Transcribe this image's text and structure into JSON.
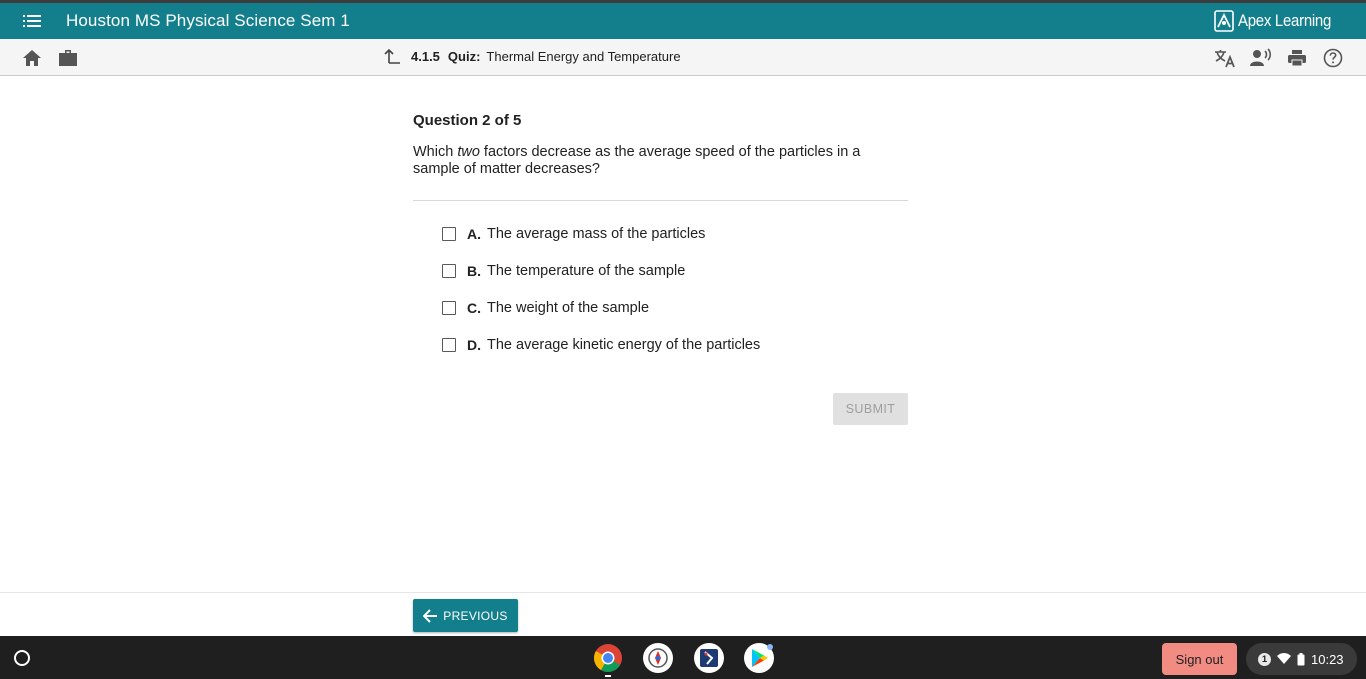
{
  "app": {
    "course_title": "Houston MS Physical Science Sem 1",
    "brand": "Apex Learning",
    "accent_color": "#137f8c"
  },
  "toolbar": {
    "left_icons": [
      "home-icon",
      "briefcase-icon"
    ],
    "breadcrumb": {
      "number": "4.1.5",
      "kind": "Quiz:",
      "title": "Thermal Energy and Temperature"
    },
    "right_icons": [
      "translate-icon",
      "text-to-speech-icon",
      "print-icon",
      "help-icon"
    ]
  },
  "question": {
    "header": "Question 2 of 5",
    "text_before": "Which ",
    "text_emphasis": "two",
    "text_after": " factors decrease as the average speed of the particles in a sample of matter decreases?",
    "choices": [
      {
        "letter": "A.",
        "label": "The average mass of the particles",
        "checked": false
      },
      {
        "letter": "B.",
        "label": "The temperature of the sample",
        "checked": false
      },
      {
        "letter": "C.",
        "label": "The weight of the sample",
        "checked": false
      },
      {
        "letter": "D.",
        "label": "The average kinetic energy of the particles",
        "checked": false
      }
    ],
    "submit_label": "SUBMIT"
  },
  "footer": {
    "previous_label": "PREVIOUS"
  },
  "shelf": {
    "apps": [
      "chrome-icon",
      "app-icon-2",
      "app-icon-3",
      "play-store-icon"
    ],
    "signout_label": "Sign out",
    "notification_count": "1",
    "time": "10:23"
  }
}
